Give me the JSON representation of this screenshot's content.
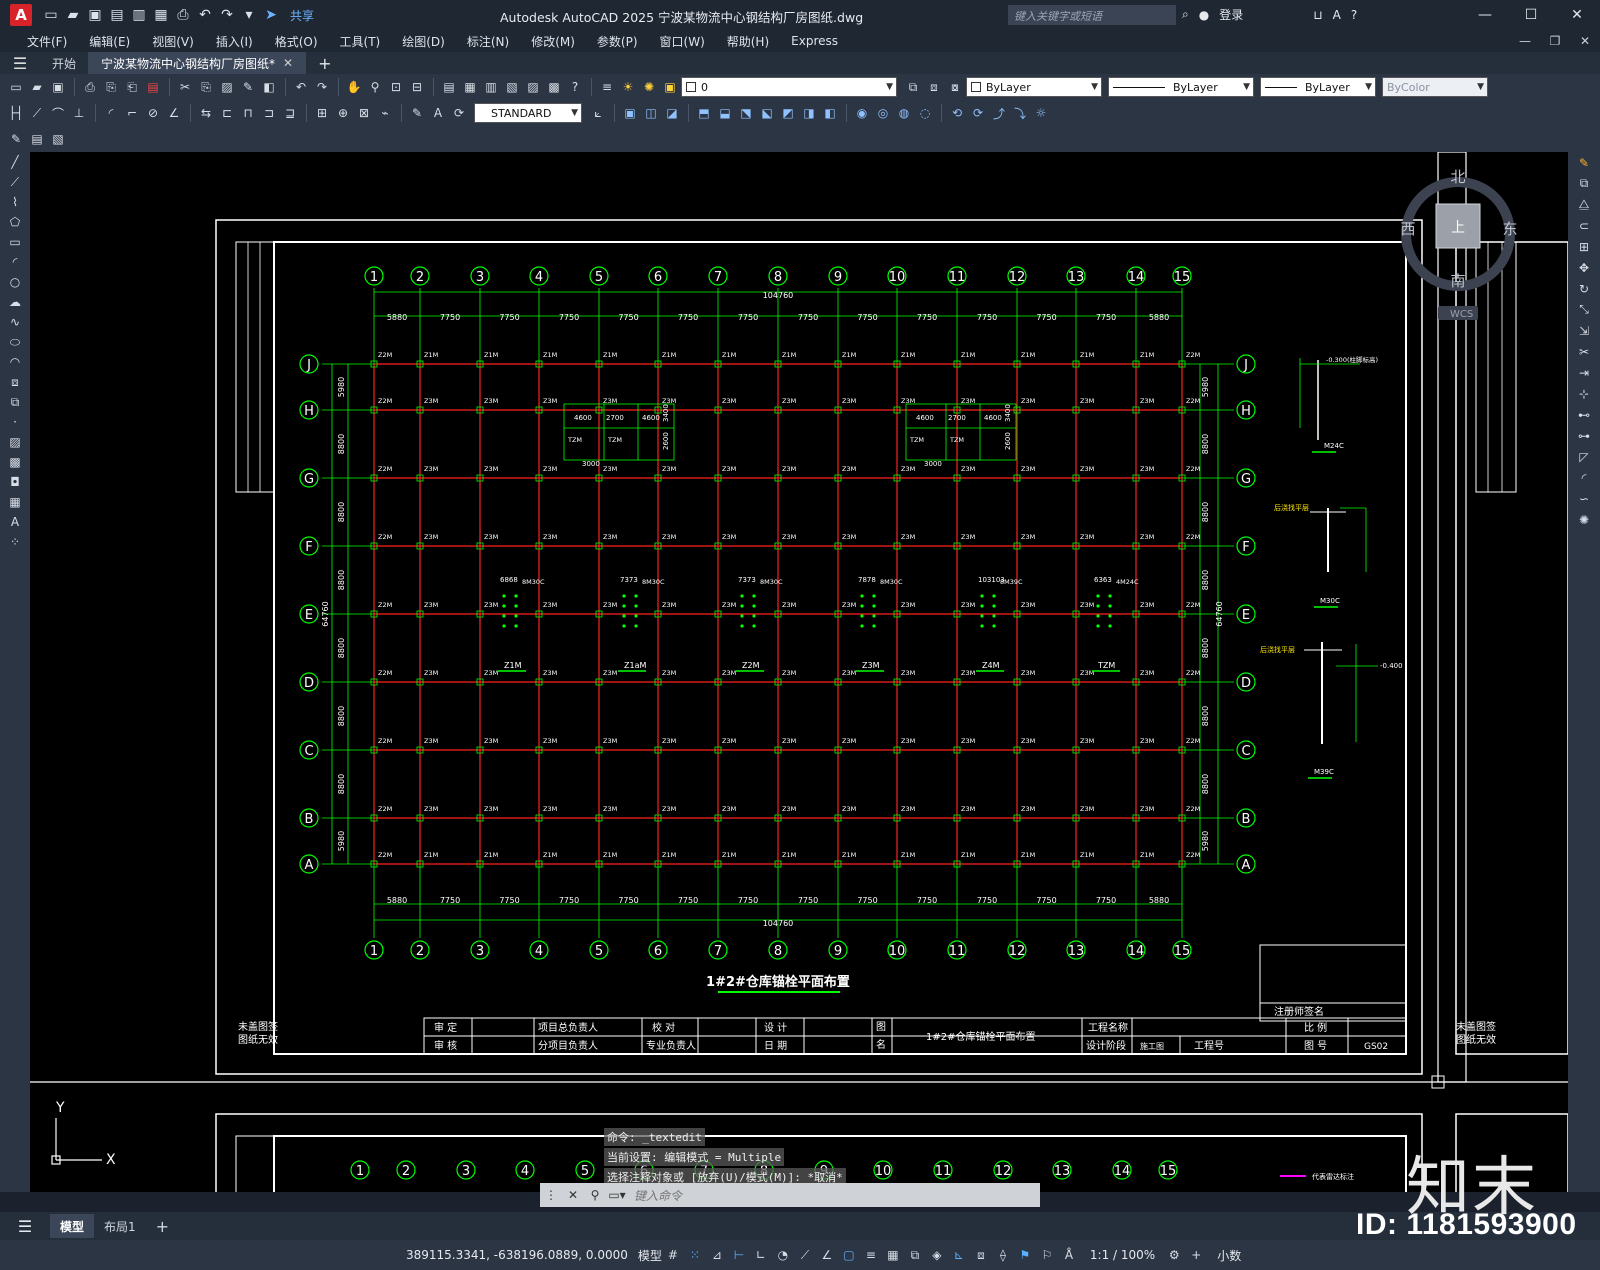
{
  "titlebar": {
    "app_letter": "A",
    "share": "共享",
    "title": "Autodesk AutoCAD 2025    宁波某物流中心钢结构厂房图纸.dwg",
    "search_placeholder": "键入关键字或短语",
    "login": "登录"
  },
  "menu": [
    "文件(F)",
    "编辑(E)",
    "视图(V)",
    "插入(I)",
    "格式(O)",
    "工具(T)",
    "绘图(D)",
    "标注(N)",
    "修改(M)",
    "参数(P)",
    "窗口(W)",
    "帮助(H)",
    "Express"
  ],
  "tabs": {
    "start": "开始",
    "drawing": "宁波某物流中心钢结构厂房图纸*"
  },
  "toolbar": {
    "layer_value": "0",
    "textstyle": "STANDARD",
    "color": "ByLayer",
    "linetype": "ByLayer",
    "lineweight": "ByLayer",
    "plotstyle": "ByColor"
  },
  "drawing": {
    "grid_numbers": [
      "1",
      "2",
      "3",
      "4",
      "5",
      "6",
      "7",
      "8",
      "9",
      "10",
      "11",
      "12",
      "13",
      "14",
      "15"
    ],
    "grid_letters": [
      "J",
      "H",
      "G",
      "F",
      "E",
      "D",
      "C",
      "B",
      "A"
    ],
    "top_dims": [
      "5880",
      "7750",
      "7750",
      "7750",
      "7750",
      "7750",
      "7750",
      "7750",
      "7750",
      "7750",
      "7750",
      "7750",
      "7750",
      "5880"
    ],
    "total_width": "104760",
    "total_height": "64760",
    "row_dims": [
      "5980",
      "8800",
      "8800",
      "8800",
      "8800",
      "8800",
      "8800",
      "5980"
    ],
    "plan_title": "1#2#仓库锚栓平面布置",
    "compass": {
      "north": "北",
      "south": "南",
      "west": "西",
      "east": "东",
      "top": "上",
      "wcs": "WCS"
    },
    "titleblock": {
      "left_note": "未盖图签\n图纸无效",
      "r1": [
        "审  定",
        "项目总负责人",
        "校  对",
        "设  计"
      ],
      "r2": [
        "审  核",
        "分项目负责人",
        "专业负责人",
        "日  期"
      ],
      "tu_ming": "图名",
      "drawing_name": "1#2#仓库锚栓平面布置",
      "gongcheng_mingcheng": "工程名称",
      "sheji_jieduan": "设计阶段",
      "shigongtu": "施工图",
      "gongchenghao": "工程号",
      "bili": "比  例",
      "tuhao": "图  号",
      "sheet_no": "GS02",
      "zhuce": "注册师签名"
    },
    "details": {
      "d1_label": "M24C",
      "d2_label": "M30C",
      "d3_label": "M39C",
      "d1_note": "-0.300(柱脚标高)",
      "d3_note": "-0.400",
      "pour_note": "后浇找平层"
    },
    "foundation_labels": [
      "Z1M",
      "Z1aM",
      "Z2M",
      "Z3M",
      "Z4M",
      "TZM"
    ],
    "foundation_dims": [
      "6868",
      "7373",
      "7373",
      "7878",
      "103103",
      "6363"
    ],
    "bolt_specs": [
      "8M30C",
      "8M30C",
      "8M30C",
      "8M30C",
      "8M39C",
      "4M24C"
    ],
    "room_dims": [
      "4600",
      "2700",
      "4600",
      "3000",
      "3400",
      "2600"
    ],
    "bottom_legend": "代表雷达标注"
  },
  "command": {
    "lines": [
      "命令:  _textedit",
      "当前设置: 编辑模式 = Multiple",
      "选择注释对象或 [放弃(U)/模式(M)]: *取消*"
    ],
    "input_placeholder": "键入命令"
  },
  "layouts": [
    "模型",
    "布局1"
  ],
  "status": {
    "coords": "389115.3341, -638196.0889, 0.0000",
    "model": "模型",
    "scale": "1:1 / 100%",
    "units": "小数"
  },
  "watermark": {
    "id": "ID: 1181593900",
    "logo": "知末"
  },
  "colors": {
    "grid_green": "#00ff00",
    "beam_red": "#ff2020",
    "frame_white": "#ffffff",
    "canvas": "#000000",
    "accent": "#5ab0ff"
  }
}
